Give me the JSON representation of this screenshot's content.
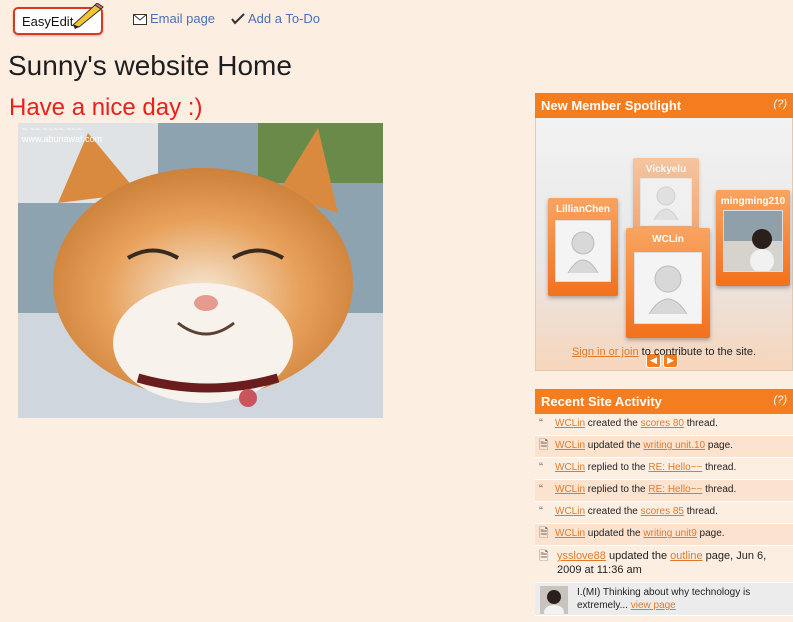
{
  "toolbar": {
    "easyedit_label": "EasyEdit",
    "email_label": "Email page",
    "todo_label": "Add a To-Do"
  },
  "page": {
    "title": "Sunny's website Home",
    "greeting": "Have a nice day :)",
    "image_watermark_line1": "~ ~~ ~~~~ ~~~",
    "image_watermark_line2": "www.abunawaf.com"
  },
  "spotlight": {
    "title": "New Member Spotlight",
    "help": "(?)",
    "members": [
      "Vickyelu",
      "LillianChen",
      "WCLin",
      "mingming210"
    ],
    "sign_in_link": "Sign in or join",
    "contribute_text": " to contribute to the site."
  },
  "activity": {
    "title": "Recent Site Activity",
    "help": "(?)",
    "items": [
      {
        "icon": "quote-icon",
        "user": "WCLin",
        "verb": " created the ",
        "target": "scores 80",
        "suffix": " thread."
      },
      {
        "icon": "page-icon",
        "user": "WCLin",
        "verb": " updated the ",
        "target": "writing unit.10",
        "suffix": " page."
      },
      {
        "icon": "quote-icon",
        "user": "WCLin",
        "verb": " replied to the ",
        "target": "RE: Hello~~",
        "suffix": " thread."
      },
      {
        "icon": "quote-icon",
        "user": "WCLin",
        "verb": " replied to the ",
        "target": "RE: Hello~~",
        "suffix": " thread."
      },
      {
        "icon": "quote-icon",
        "user": "WCLin",
        "verb": " created the ",
        "target": "scores 85",
        "suffix": " thread."
      },
      {
        "icon": "page-icon",
        "user": "WCLin",
        "verb": " updated the ",
        "target": "writing unit9",
        "suffix": " page."
      },
      {
        "icon": "page-icon",
        "user": "ysslove88",
        "verb": " updated the ",
        "target": "outline",
        "suffix": " page, Jun 6, 2009 at 11:36 am"
      }
    ],
    "twitter_text": "I.(MI) Thinking about why technology is extremely... ",
    "twitter_link": "view page"
  },
  "colors": {
    "background": "#fdeee2",
    "accent": "#f47d20",
    "greeting": "#e8211b",
    "link": "#4b6fb8"
  }
}
